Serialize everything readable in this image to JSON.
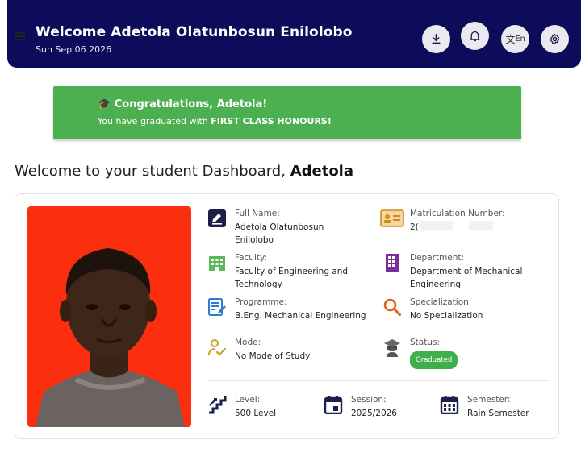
{
  "header": {
    "title": "Welcome Adetola Olatunbosun Enilolobo",
    "date": "Sun Sep 06 2026",
    "lang_label": "En"
  },
  "banner": {
    "emoji": "🎓",
    "title": "Congratulations, Adetola!",
    "text_prefix": "You have graduated with ",
    "text_bold": "FIRST CLASS HONOURS!"
  },
  "dashboard": {
    "welcome_prefix": "Welcome to your student Dashboard, ",
    "first_name": "Adetola"
  },
  "profile": {
    "full_name_label": "Full Name:",
    "full_name": "Adetola Olatunbosun Enilolobo",
    "matric_label": "Matriculation Number:",
    "matric": "2(",
    "faculty_label": "Faculty:",
    "faculty": "Faculty of Engineering and Technology",
    "department_label": "Department:",
    "department": "Department of Mechanical Engineering",
    "programme_label": "Programme:",
    "programme": "B.Eng. Mechanical Engineering",
    "specialization_label": "Specialization:",
    "specialization": "No Specialization",
    "mode_label": "Mode:",
    "mode": "No Mode of Study",
    "status_label": "Status:",
    "status": "Graduated",
    "level_label": "Level:",
    "level": "500 Level",
    "session_label": "Session:",
    "session": "2025/2026",
    "semester_label": "Semester:",
    "semester": "Rain Semester"
  },
  "colors": {
    "header_bg": "#0c0c5a",
    "banner_bg": "#4caf50",
    "photo_bg": "#fb2f0f",
    "badge_bg": "#3faf4c"
  }
}
